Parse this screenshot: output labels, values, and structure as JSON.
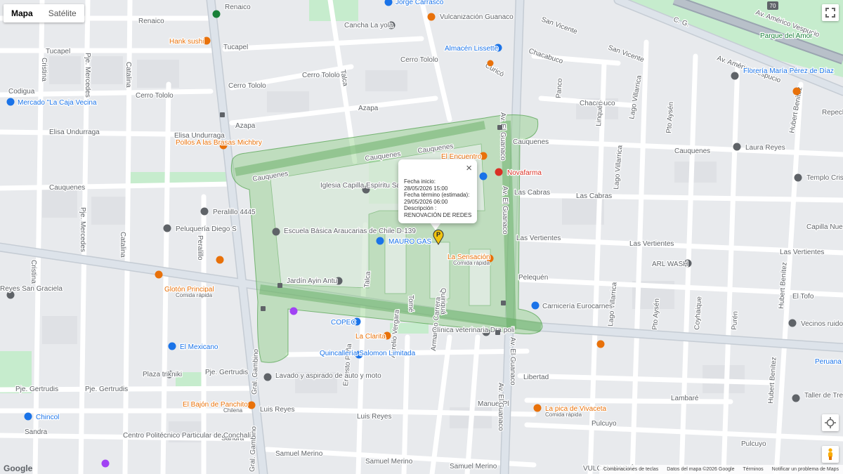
{
  "map_type": {
    "map_label": "Mapa",
    "satellite_label": "Satélite"
  },
  "streets": {
    "renaico": "Renaico",
    "tucapel": "Tucapel",
    "cerro_tololo": "Cerro Tololo",
    "azapa": "Azapa",
    "elisa_unduraga": "Elisa Undurraga",
    "cauquenes": "Cauquenes",
    "las_vertientes": "Las Vertientes",
    "las_cabras": "Las Cabras",
    "pelequen": "Pelequén",
    "libertad": "Libertad",
    "lambare": "Lambaré",
    "pulcuyo": "Pulcuyo",
    "samuel_merino": "Samuel Merino",
    "manuel_pl": "Manuel Pl",
    "luis_reyes": "Luis Reyes",
    "sandra": "Sandra",
    "pje_gertrudis": "Pje. Gertrudis",
    "av_el_guanaco": "Av. El Guanaco",
    "gral_gambino": "Gral. Gambino",
    "lago_villarrica": "Lago Villarrica",
    "pto_aysen": "Pto Aysén",
    "coyhaique": "Coyhaique",
    "puren": "Purén",
    "hubert_benitez": "Hubert Benítez",
    "san_vicente": "San Vicente",
    "chacabuco": "Chacabuco",
    "curico": "Curicó",
    "av_americo_vespucio": "Av. Américo Vespucio",
    "talca": "Talca",
    "tome": "Tomé",
    "quirigua": "Quiriguá",
    "amado_carrera": "Armando Carrera",
    "ernesto_pena": "Ernesto Peña",
    "aurelio_vergara": "Aurelio Vergara",
    "cristina": "Cristina",
    "pje_mercedes": "Pje. Mercedes",
    "catalina": "Catalina",
    "codigua": "Codigua",
    "peralillo": "Peralillo",
    "panco": "Panco",
    "linquen": "Linquén",
    "el_tofo": "El Tofo",
    "c_g": "C. G."
  },
  "pois": {
    "jorge_carrasco": "Jorge Carrasco",
    "vulcanizacion_guanaco": "Vulcanización Guanaco",
    "cancha_la_yola": "Cancha La yola",
    "hank_sushi": "Hank sushi",
    "almacen_lissette": "Almacén Lissette",
    "parque_del_amor": "Parque del Amor",
    "floreria": "Florería María Pérez de Díaz",
    "mercado_caja": "Mercado \"La Caja Vecina",
    "pollos_brasas": "Pollos A las Brasas Michbry",
    "el_encuentro": "El Encuentro",
    "novafarma": "Novafarma",
    "iglesia": "Iglesia Capilla Espíritu Santo",
    "laura_reyes": "Laura Reyes",
    "templo": "Templo Cristo Nuestro Pastor",
    "perarillo_4445": "Peralillo 4445",
    "peluqueria_diego": "Peluquería Diego S",
    "escuela": "Escuela Básica Araucarias de Chile D-139",
    "mauro_gas": "MAURO GAS",
    "capilla_nuestra": "Capilla Nuestra Señora De Las Nieves",
    "la_sensacion": "La Sensación",
    "la_sensacion_sub": "Comida rápida",
    "arl_wash": "ARL WASH",
    "gloton_principal": "Glotón Principal",
    "gloton_sub": "Comida rápida",
    "reyes_san_graciela": "Reyes San Graciela",
    "jardin": "Jardín Ayin Antu",
    "carniceria": "Carnicería Eurocarnes",
    "copec": "COPEC",
    "clinica": "Clínica veterinaria Dra poli",
    "vecinos": "Vecinos ruidosos",
    "la_clarita": "La Clarita",
    "el_mexicano": "El Mexicano",
    "quincalleria": "Quincallería Salomon Limitada",
    "plaza_trikniki": "Plaza trikniki",
    "lavado": "Lavado y aspirado de auto y moto",
    "peruana": "Peruana C",
    "bajon": "El Bajón de Panchito",
    "bajon_sub": "Chilena",
    "la_pica": "La pica de Vivaceta",
    "la_pica_sub": "Comida rápida",
    "taller": "Taller de Tren Delantero, Alineac",
    "chincol": "Chincol",
    "centro_politecnico": "Centro Politécnico Particular de Conchalí",
    "vulcanizacion2": "VULCANIZACIÓ",
    "repechaje": "Repechaje focos y"
  },
  "route_badge": "70",
  "info_window": {
    "close": "×",
    "line1": "Fecha inicio:",
    "line2": "28/05/2026 15:00",
    "line3": "Fecha término (estimada):",
    "line4": "29/05/2026 06:00",
    "line5": "Descripción :",
    "line6": "RENOVACIÓN DE REDES"
  },
  "marker_label": "P",
  "footer": {
    "keyboard": "Combinaciones de teclas",
    "mapdata": "Datos del mapa ©2026 Google",
    "terms": "Términos",
    "report": "Notificar un problema de Maps"
  },
  "google_logo": "Google",
  "colors": {
    "polygon_fill": "#8fcf86",
    "polygon_stroke": "#5ea85a",
    "road": "#ffffff",
    "main_road": "#dde3ea",
    "park": "#c6eccd",
    "block": "#e8eaed",
    "poi_orange": "#e8710a",
    "poi_blue": "#1a73e8",
    "poi_gray": "#5f6368",
    "poi_red": "#d93025",
    "poi_green": "#188038"
  }
}
